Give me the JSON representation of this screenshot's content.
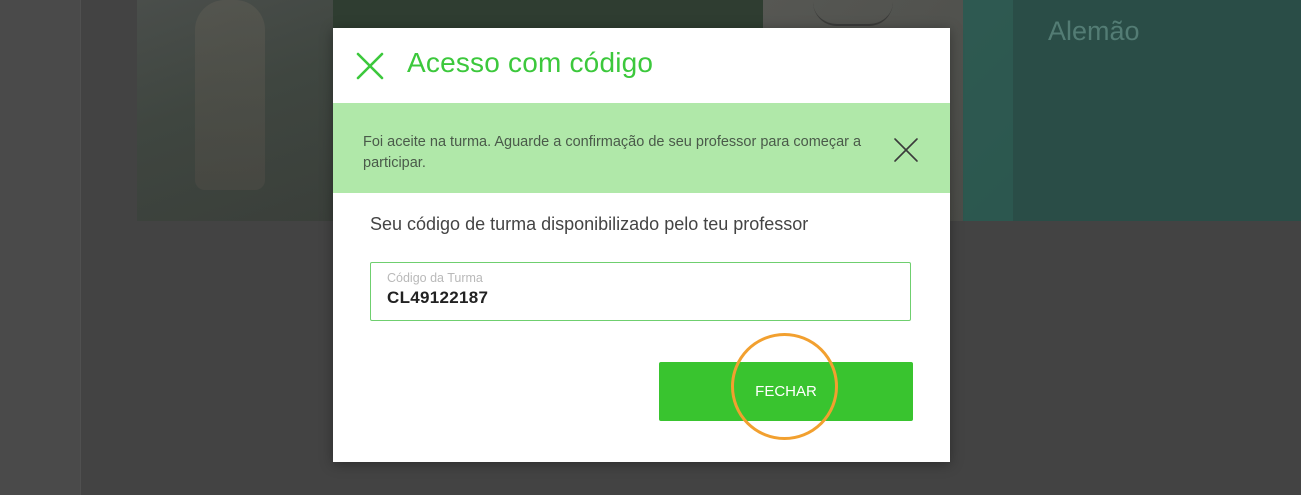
{
  "background": {
    "card_title": "Alemão"
  },
  "modal": {
    "close_icon": "close-icon",
    "title": "Acesso com código",
    "alert": {
      "message": "Foi aceite na turma. Aguarde a confirmação de seu professor para começar a participar.",
      "close_icon": "close-icon"
    },
    "prompt": "Seu código de turma disponibilizado pelo teu professor",
    "code_field": {
      "label": "Código da Turma",
      "value": "CL49122187"
    },
    "close_button_label": "FECHAR"
  },
  "colors": {
    "accent_green": "#3cc83c",
    "alert_bg": "#b0e8a9",
    "button_green": "#39c42f",
    "highlight_ring": "#f2a02f"
  }
}
